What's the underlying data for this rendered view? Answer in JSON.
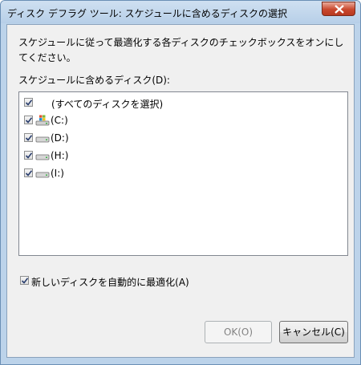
{
  "window": {
    "title": "ディスク デフラグ ツール: スケジュールに含めるディスクの選択"
  },
  "instruction": "スケジュールに従って最適化する各ディスクのチェックボックスをオンにしてください。",
  "disk_list": {
    "label": "スケジュールに含めるディスク(D):",
    "select_all": {
      "label": "(すべてのディスクを選択)",
      "checked": true
    },
    "items": [
      {
        "label": "(C:)",
        "checked": true,
        "icon": "windows-drive-icon"
      },
      {
        "label": "(D:)",
        "checked": true,
        "icon": "hard-drive-icon"
      },
      {
        "label": "(H:)",
        "checked": true,
        "icon": "hard-drive-icon"
      },
      {
        "label": "(I:)",
        "checked": true,
        "icon": "hard-drive-icon"
      }
    ]
  },
  "auto_optimize": {
    "label": "新しいディスクを自動的に最適化(A)",
    "checked": true
  },
  "buttons": {
    "ok": "OK(O)",
    "cancel": "キャンセル(C)"
  }
}
